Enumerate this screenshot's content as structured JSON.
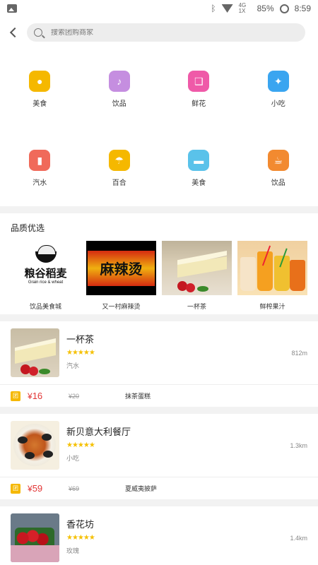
{
  "status_bar": {
    "battery": "85%",
    "time": "8:59"
  },
  "search": {
    "placeholder": "搜索团购商家"
  },
  "categories": [
    {
      "label": "美食",
      "icon": "chef-hat-icon",
      "color": "#f5b800",
      "glyph": "●"
    },
    {
      "label": "饮品",
      "icon": "microphone-icon",
      "color": "#c58ee0",
      "glyph": "♪"
    },
    {
      "label": "鲜花",
      "icon": "book-icon",
      "color": "#ef5aa8",
      "glyph": "❑"
    },
    {
      "label": "小吃",
      "icon": "cart-icon",
      "color": "#3aa5f0",
      "glyph": "✦"
    },
    {
      "label": "汽水",
      "icon": "bottle-icon",
      "color": "#f06a5a",
      "glyph": "▮"
    },
    {
      "label": "百合",
      "icon": "umbrella-icon",
      "color": "#f5b800",
      "glyph": "☂"
    },
    {
      "label": "美食",
      "icon": "car-icon",
      "color": "#5ac2ea",
      "glyph": "▬"
    },
    {
      "label": "饮品",
      "icon": "coffee-cup-icon",
      "color": "#f28a30",
      "glyph": "☕"
    }
  ],
  "quality": {
    "title": "品质优选",
    "items": [
      {
        "label": "饮品美食城",
        "logo_cn": "粮谷稻麦",
        "logo_en": "Grain rice & wheat"
      },
      {
        "label": "又一村麻辣烫",
        "sign": "麻辣烫"
      },
      {
        "label": "一杯茶"
      },
      {
        "label": "鲜榨果汁"
      }
    ]
  },
  "deals": [
    {
      "name": "一杯茶",
      "stars": "★★★★★",
      "sub": "汽水",
      "distance": "812m",
      "tag": "团",
      "price": "16",
      "currency": "¥",
      "original": "¥20",
      "dish": "抹茶蛋糕"
    },
    {
      "name": "新贝意大利餐厅",
      "stars": "★★★★★",
      "sub": "小吃",
      "distance": "1.3km",
      "tag": "团",
      "price": "59",
      "currency": "¥",
      "original": "¥69",
      "dish": "夏威夷披萨"
    },
    {
      "name": "香花坊",
      "stars": "★★★★★",
      "sub": "玫瑰",
      "distance": "1.4km"
    }
  ]
}
